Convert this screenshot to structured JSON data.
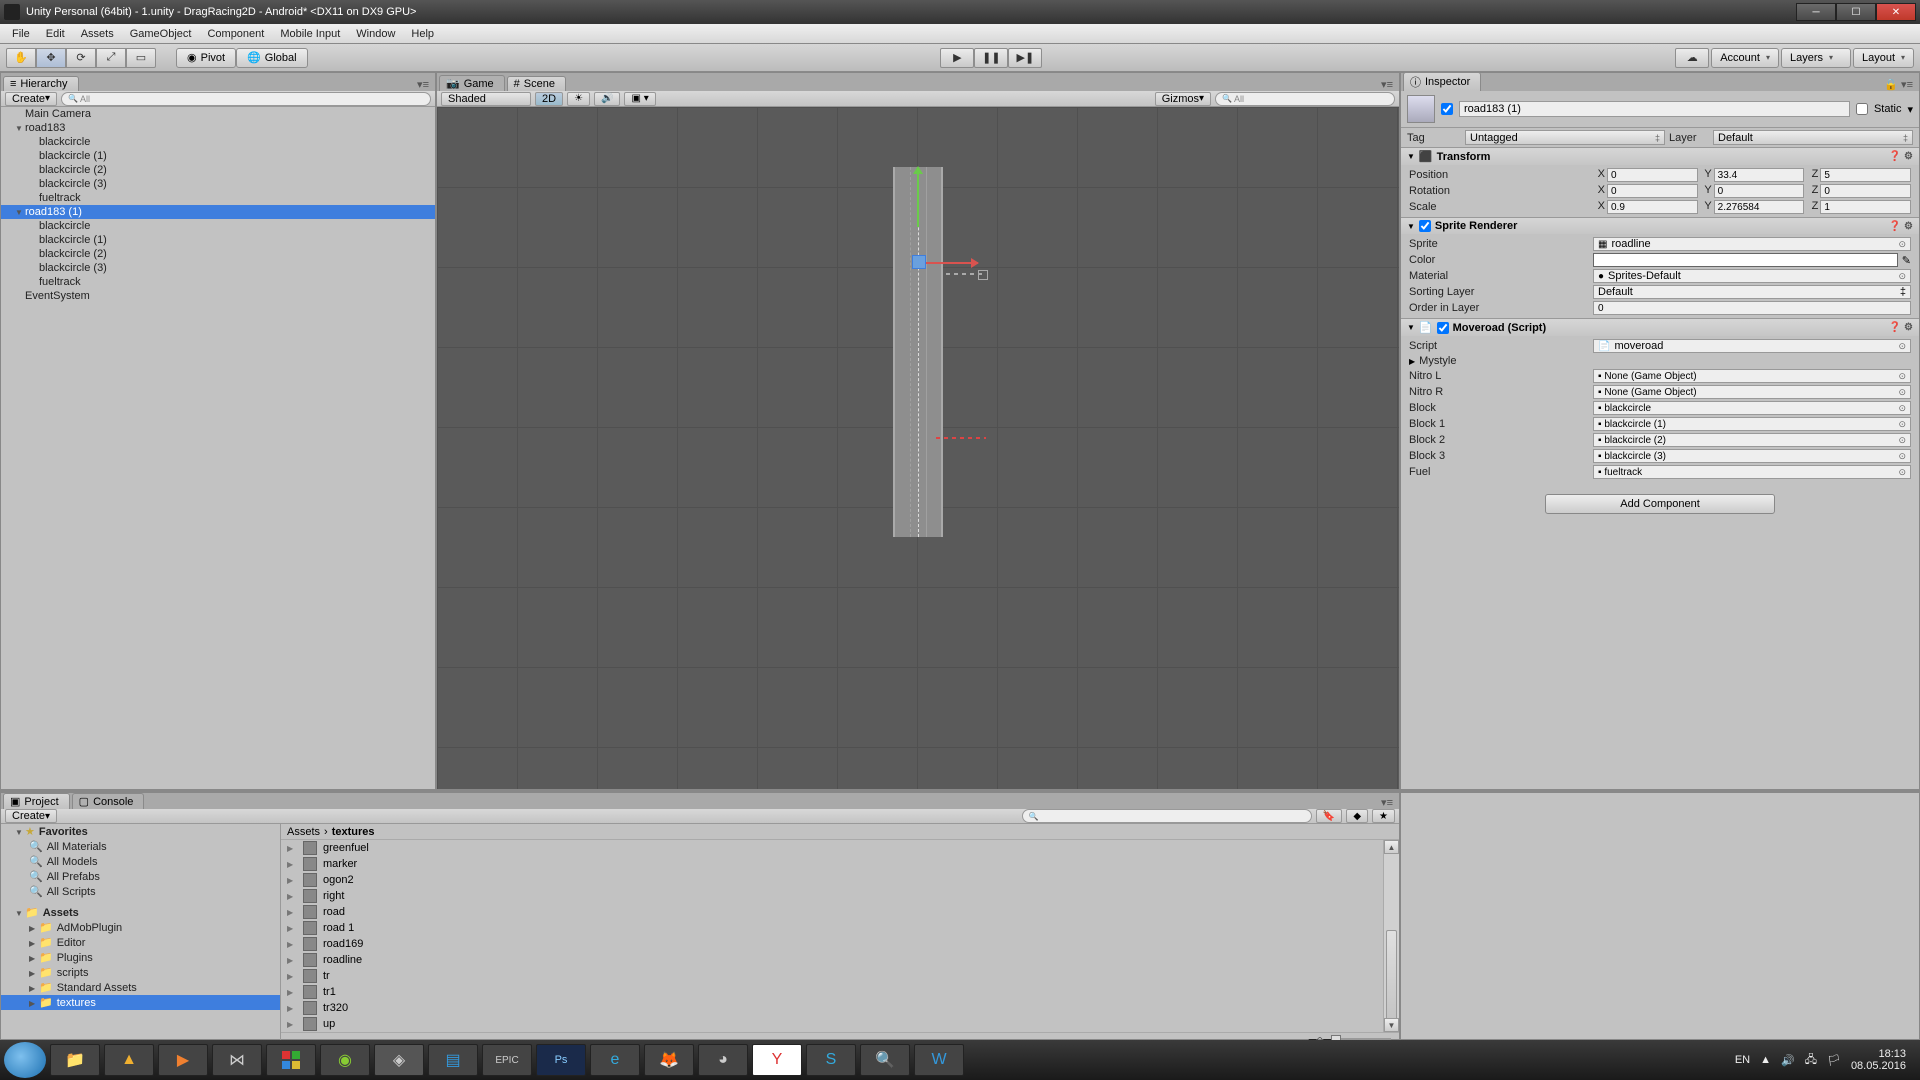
{
  "title": "Unity Personal (64bit) - 1.unity - DragRacing2D - Android* <DX11 on DX9 GPU>",
  "menus": [
    "File",
    "Edit",
    "Assets",
    "GameObject",
    "Component",
    "Mobile Input",
    "Window",
    "Help"
  ],
  "toolbar": {
    "pivot": "Pivot",
    "global": "Global",
    "account": "Account",
    "layers": "Layers",
    "layout": "Layout"
  },
  "panels": {
    "hierarchy": "Hierarchy",
    "game": "Game",
    "scene": "Scene",
    "inspector": "Inspector",
    "project": "Project",
    "console": "Console"
  },
  "hierarchy_toolbar": {
    "create": "Create",
    "search_placeholder": "All"
  },
  "hierarchy": [
    {
      "name": "Main Camera",
      "indent": 0
    },
    {
      "name": "road183",
      "indent": 0,
      "expanded": true
    },
    {
      "name": "blackcircle",
      "indent": 1
    },
    {
      "name": "blackcircle (1)",
      "indent": 1
    },
    {
      "name": "blackcircle (2)",
      "indent": 1
    },
    {
      "name": "blackcircle (3)",
      "indent": 1
    },
    {
      "name": "fueltrack",
      "indent": 1
    },
    {
      "name": "road183 (1)",
      "indent": 0,
      "selected": true,
      "expanded": true
    },
    {
      "name": "blackcircle",
      "indent": 1
    },
    {
      "name": "blackcircle (1)",
      "indent": 1
    },
    {
      "name": "blackcircle (2)",
      "indent": 1
    },
    {
      "name": "blackcircle (3)",
      "indent": 1
    },
    {
      "name": "fueltrack",
      "indent": 1
    },
    {
      "name": "EventSystem",
      "indent": 0
    }
  ],
  "scene_toolbar": {
    "shaded": "Shaded",
    "mode": "2D",
    "gizmos": "Gizmos",
    "search_placeholder": "All"
  },
  "inspector": {
    "name": "road183 (1)",
    "static": "Static",
    "tag_label": "Tag",
    "tag": "Untagged",
    "layer_label": "Layer",
    "layer": "Default",
    "transform": {
      "title": "Transform",
      "position": {
        "label": "Position",
        "x": "0",
        "y": "33.4",
        "z": "5"
      },
      "rotation": {
        "label": "Rotation",
        "x": "0",
        "y": "0",
        "z": "0"
      },
      "scale": {
        "label": "Scale",
        "x": "0.9",
        "y": "2.276584",
        "z": "1"
      }
    },
    "sprite_renderer": {
      "title": "Sprite Renderer",
      "sprite_label": "Sprite",
      "sprite": "roadline",
      "color_label": "Color",
      "material_label": "Material",
      "material": "Sprites-Default",
      "sorting_label": "Sorting Layer",
      "sorting": "Default",
      "order_label": "Order in Layer",
      "order": "0"
    },
    "script": {
      "title": "Moveroad (Script)",
      "script_label": "Script",
      "script": "moveroad",
      "mystyle": "Mystyle",
      "rows": [
        {
          "label": "Nitro L",
          "value": "None (Game Object)"
        },
        {
          "label": "Nitro R",
          "value": "None (Game Object)"
        },
        {
          "label": "Block",
          "value": "blackcircle"
        },
        {
          "label": "Block 1",
          "value": "blackcircle (1)"
        },
        {
          "label": "Block 2",
          "value": "blackcircle (2)"
        },
        {
          "label": "Block 3",
          "value": "blackcircle (3)"
        },
        {
          "label": "Fuel",
          "value": "fueltrack"
        }
      ]
    },
    "add_component": "Add Component"
  },
  "project": {
    "create": "Create",
    "favorites_label": "Favorites",
    "favorites": [
      "All Materials",
      "All Models",
      "All Prefabs",
      "All Scripts"
    ],
    "assets_label": "Assets",
    "assets": [
      "AdMobPlugin",
      "Editor",
      "Plugins",
      "scripts",
      "Standard Assets",
      "textures"
    ],
    "assets_selected": "textures",
    "breadcrumb": [
      "Assets",
      "textures"
    ],
    "items": [
      "greenfuel",
      "marker",
      "ogon2",
      "right",
      "road",
      "road 1",
      "road169",
      "roadline",
      "tr",
      "tr1",
      "tr320",
      "up"
    ]
  },
  "tray": {
    "lang": "EN",
    "time": "18:13",
    "date": "08.05.2016"
  }
}
